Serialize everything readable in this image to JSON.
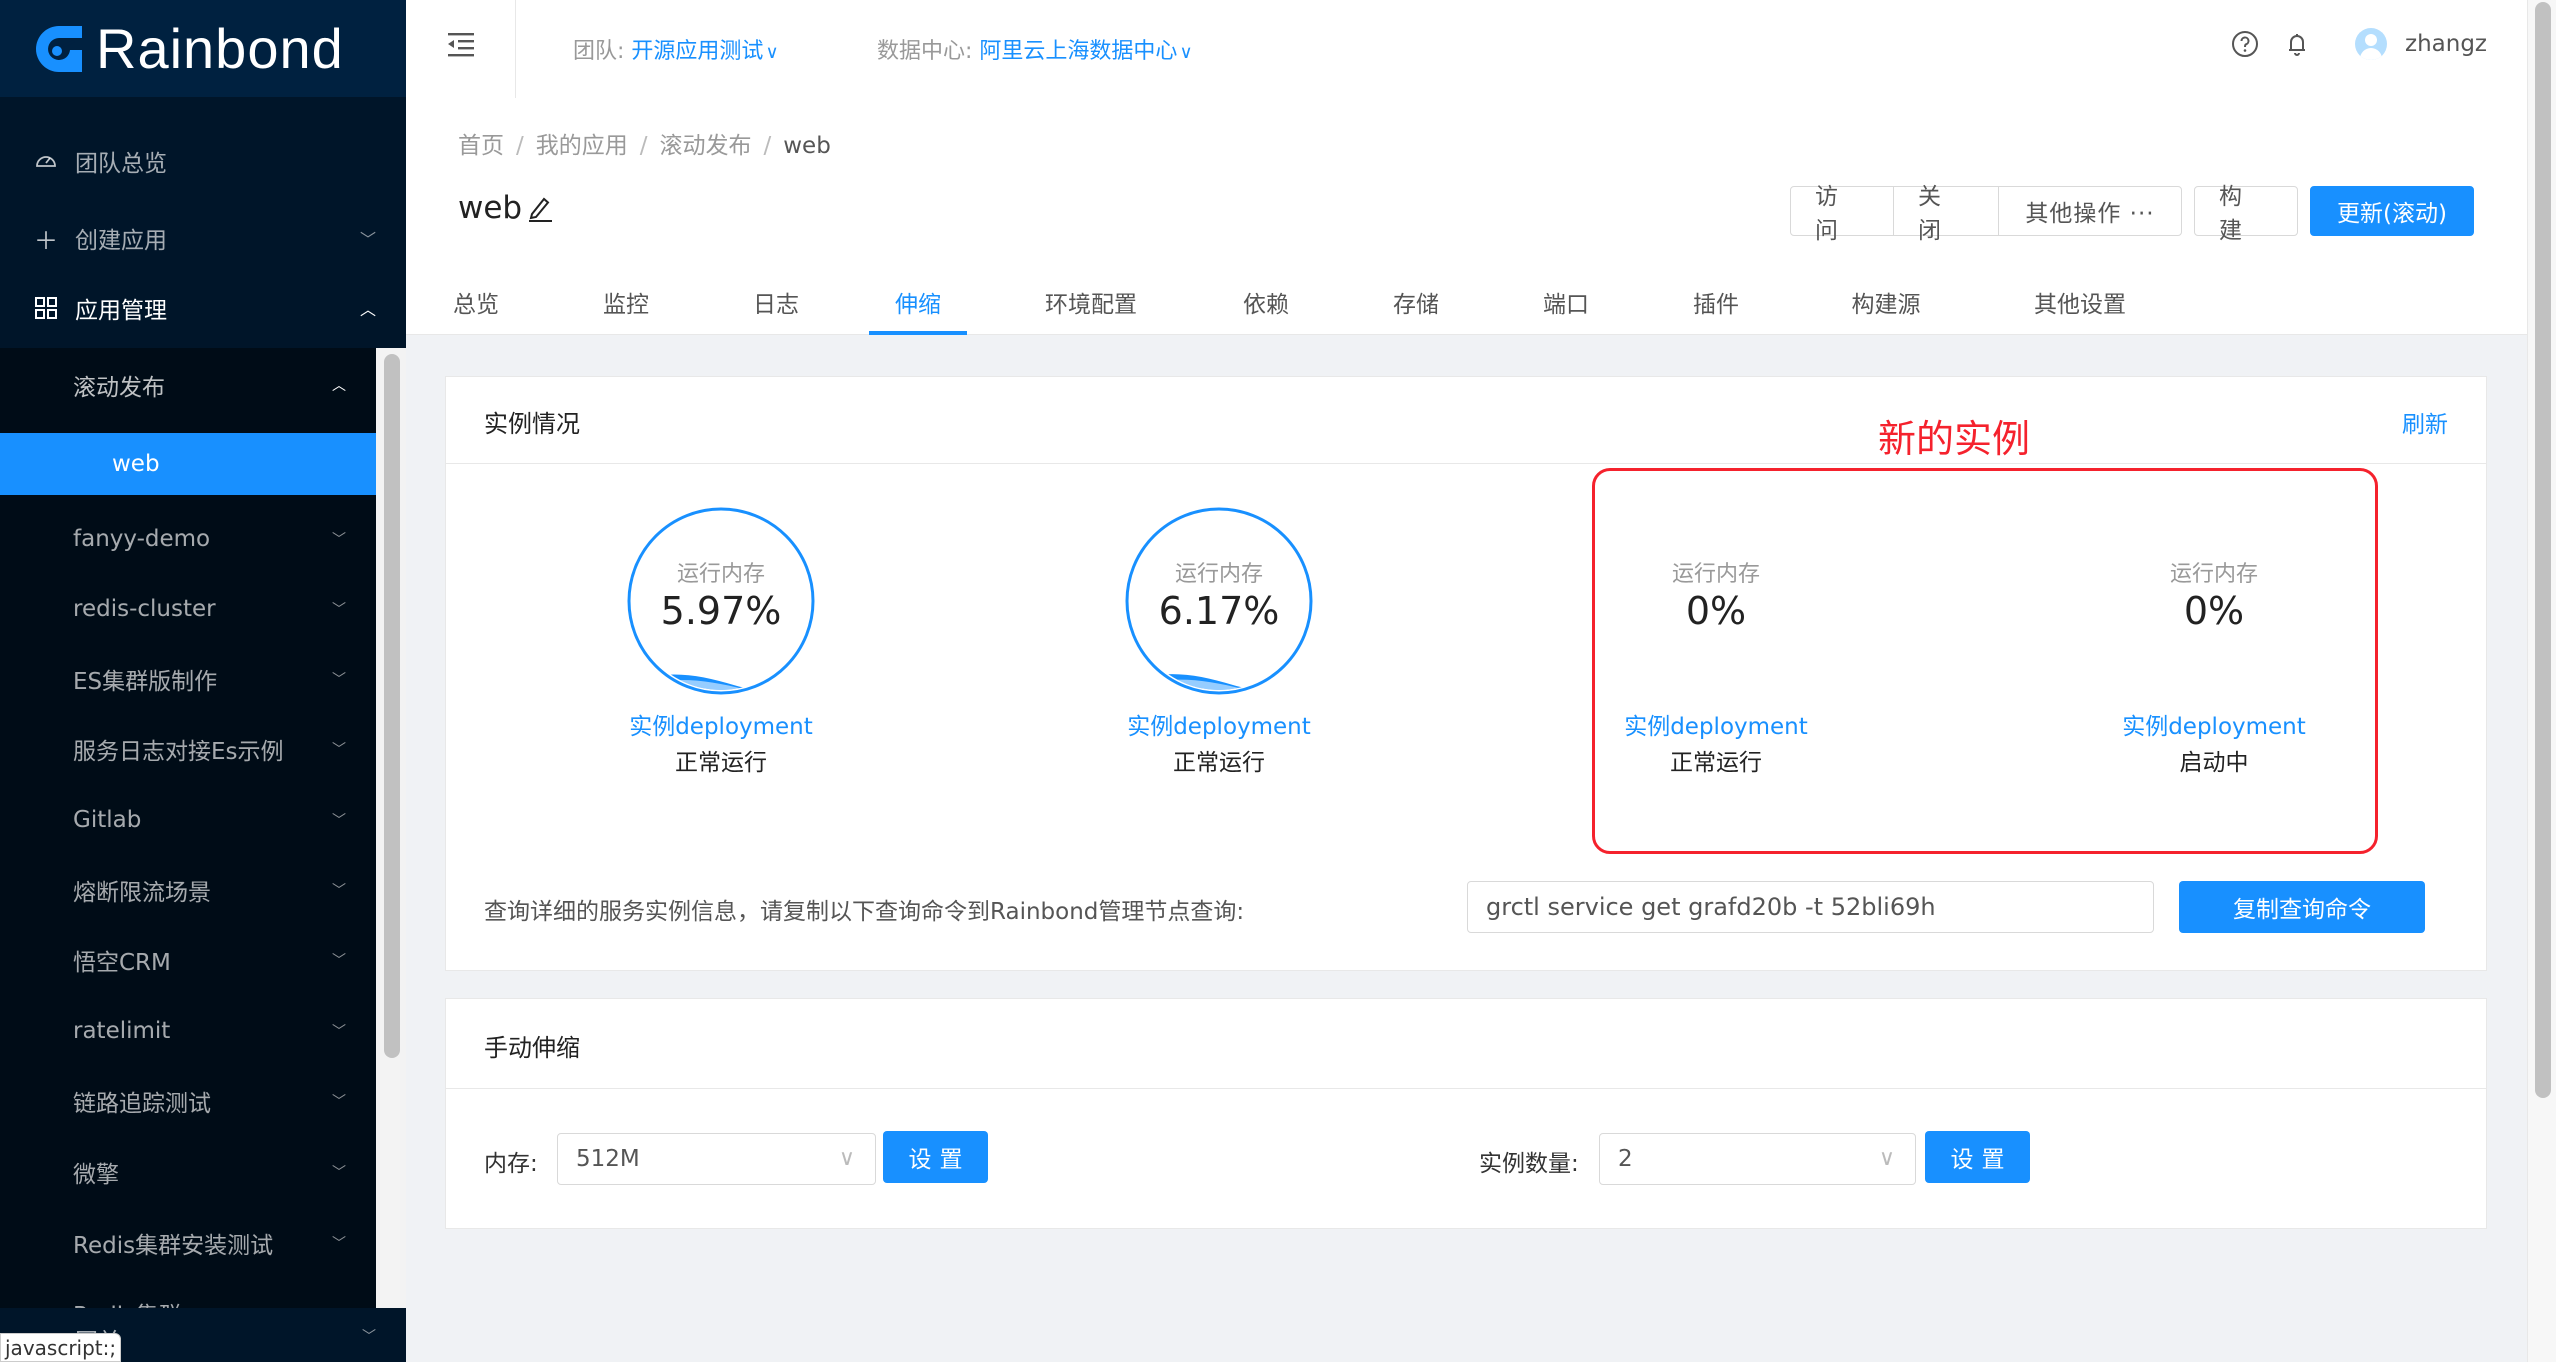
{
  "app": {
    "logo_text": "Rainbond"
  },
  "sidebar": {
    "top_items": [
      {
        "label": "团队总览",
        "icon": "dashboard-icon"
      },
      {
        "label": "创建应用",
        "icon": "plus-icon"
      },
      {
        "label": "应用管理",
        "icon": "appstore-icon"
      }
    ],
    "groups": [
      {
        "label": "滚动发布",
        "expanded": true,
        "children": [
          {
            "label": "web",
            "active": true
          }
        ]
      },
      {
        "label": "fanyy-demo"
      },
      {
        "label": "redis-cluster"
      },
      {
        "label": "ES集群版制作"
      },
      {
        "label": "服务日志对接Es示例"
      },
      {
        "label": "Gitlab"
      },
      {
        "label": "熔断限流场景"
      },
      {
        "label": "悟空CRM"
      },
      {
        "label": "ratelimit"
      },
      {
        "label": "链路追踪测试"
      },
      {
        "label": "微擎"
      },
      {
        "label": "Redis集群安装测试"
      },
      {
        "label": "Redis集群"
      }
    ],
    "bottom_item": {
      "label": "网关"
    },
    "tooltip": "javascript:;"
  },
  "header": {
    "team_label": "团队:",
    "team_value": "开源应用测试",
    "datacenter_label": "数据中心:",
    "datacenter_value": "阿里云上海数据中心",
    "username": "zhangz"
  },
  "breadcrumb": [
    "首页",
    "我的应用",
    "滚动发布",
    "web"
  ],
  "page": {
    "title": "web",
    "actions": {
      "visit": "访 问",
      "close": "关 闭",
      "more": "其他操作 ···",
      "build": "构 建",
      "update": "更新(滚动)"
    },
    "tabs": [
      {
        "label": "总览"
      },
      {
        "label": "监控"
      },
      {
        "label": "日志"
      },
      {
        "label": "伸缩",
        "active": true
      },
      {
        "label": "环境配置"
      },
      {
        "label": "依赖"
      },
      {
        "label": "存储"
      },
      {
        "label": "端口"
      },
      {
        "label": "插件"
      },
      {
        "label": "构建源"
      },
      {
        "label": "其他设置"
      }
    ]
  },
  "instances_card": {
    "title": "实例情况",
    "refresh": "刷新",
    "annotation": "新的实例",
    "instances": [
      {
        "mem_label": "运行内存",
        "mem_value": "5.97%",
        "mem_fraction": 0.0597,
        "name": "实例deployment",
        "status": "正常运行",
        "gauge": true
      },
      {
        "mem_label": "运行内存",
        "mem_value": "6.17%",
        "mem_fraction": 0.0617,
        "name": "实例deployment",
        "status": "正常运行",
        "gauge": true
      },
      {
        "mem_label": "运行内存",
        "mem_value": "0%",
        "mem_fraction": 0,
        "name": "实例deployment",
        "status": "正常运行",
        "gauge": false
      },
      {
        "mem_label": "运行内存",
        "mem_value": "0%",
        "mem_fraction": 0,
        "name": "实例deployment",
        "status": "启动中",
        "gauge": false
      }
    ],
    "query_text": "查询详细的服务实例信息，请复制以下查询命令到Rainbond管理节点查询:",
    "query_command": "grctl service get grafd20b -t 52bli69h",
    "copy_button": "复制查询命令"
  },
  "scale_card": {
    "title": "手动伸缩",
    "memory_label": "内存:",
    "memory_value": "512M",
    "memory_set": "设置",
    "count_label": "实例数量:",
    "count_value": "2",
    "count_set": "设置"
  },
  "colors": {
    "primary": "#1890ff",
    "sidebar_bg": "#001529",
    "annotation_red": "#f5222d"
  }
}
